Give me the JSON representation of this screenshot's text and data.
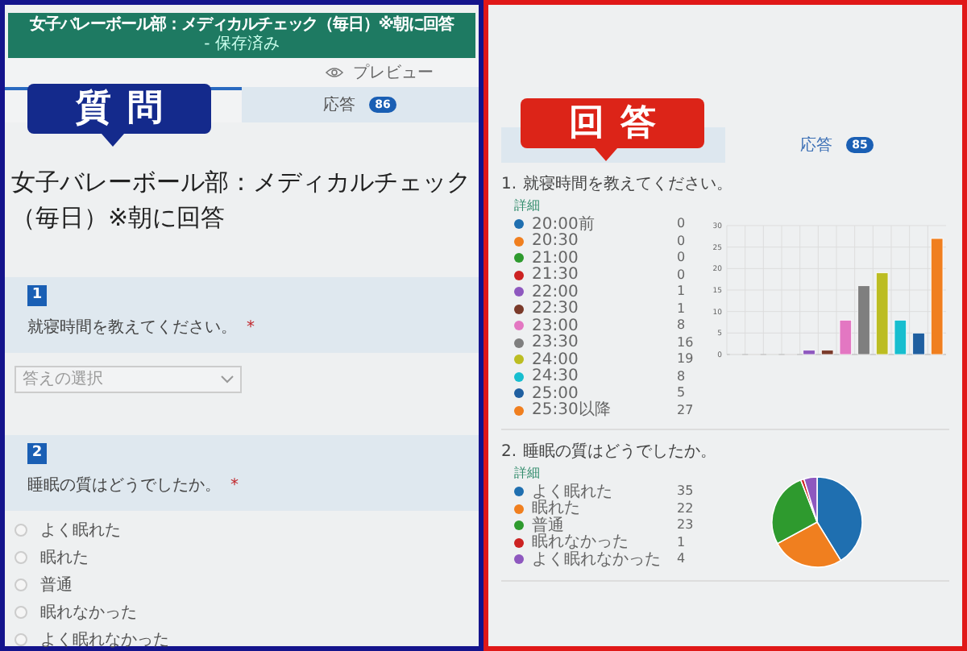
{
  "form": {
    "header": {
      "title": "女子バレーボール部：メディカルチェック（毎日）※朝に回答",
      "status": "- 保存済み"
    },
    "preview": "プレビュー",
    "tabs": [
      {
        "selected": true
      },
      {
        "label": "応答",
        "badge": "86",
        "selected": false
      }
    ],
    "callout": "質問",
    "title": "女子バレーボール部：メディカルチェック（毎日）※朝に回答",
    "questions": [
      {
        "number": "1",
        "text": "就寝時間を教えてください。",
        "mark": "*",
        "kind": "dropdown",
        "placeholder": "答えの選択"
      },
      {
        "number": "2",
        "text": "睡眠の質はどうでしたか。",
        "mark": "*",
        "kind": "choice",
        "options": [
          {
            "label": "よく眠れた",
            "selected": false
          },
          {
            "label": "眠れた",
            "selected": false
          },
          {
            "label": "普通",
            "selected": false
          },
          {
            "label": "眠れなかった",
            "selected": false
          },
          {
            "label": "よく眠れなかった",
            "selected": false
          }
        ]
      }
    ]
  },
  "responses": {
    "tabs": [
      {
        "selected": false
      },
      {
        "label": "応答",
        "badge": "85",
        "selected": true
      }
    ],
    "callout": "回答",
    "questions": [
      {
        "number": "1.",
        "text": "就寝時間を教えてください。",
        "details": "詳細",
        "items": [
          {
            "label": "20:00前",
            "count": "0",
            "color": "#1f6fb0"
          },
          {
            "label": "20:30",
            "count": "0",
            "color": "#f07f1f"
          },
          {
            "label": "21:00",
            "count": "0",
            "color": "#2e9a2e"
          },
          {
            "label": "21:30",
            "count": "0",
            "color": "#cc2222"
          },
          {
            "label": "22:00",
            "count": "1",
            "color": "#8e58bf"
          },
          {
            "label": "22:30",
            "count": "1",
            "color": "#7a3a2a"
          },
          {
            "label": "23:00",
            "count": "8",
            "color": "#e377c2"
          },
          {
            "label": "23:30",
            "count": "16",
            "color": "#7f7f7f"
          },
          {
            "label": "24:00",
            "count": "19",
            "color": "#bcbd22"
          },
          {
            "label": "24:30",
            "count": "8",
            "color": "#17becf"
          },
          {
            "label": "25:00",
            "count": "5",
            "color": "#1f5fa0"
          },
          {
            "label": "25:30以降",
            "count": "27",
            "color": "#f07f1f"
          }
        ],
        "chart_data": {
          "type": "bar",
          "values": [
            0,
            0,
            0,
            0,
            1,
            1,
            8,
            16,
            19,
            8,
            5,
            27
          ],
          "ylim": [
            0,
            30
          ],
          "yticks": [
            0,
            5,
            10,
            15,
            20,
            25,
            30
          ],
          "grid": true
        }
      },
      {
        "number": "2.",
        "text": "睡眠の質はどうでしたか。",
        "details": "詳細",
        "items": [
          {
            "label": "よく眠れた",
            "count": "35",
            "color": "#1f6fb0"
          },
          {
            "label": "眠れた",
            "count": "22",
            "color": "#f07f1f"
          },
          {
            "label": "普通",
            "count": "23",
            "color": "#2e9a2e"
          },
          {
            "label": "眠れなかった",
            "count": "1",
            "color": "#cc2222"
          },
          {
            "label": "よく眠れなかった",
            "count": "4",
            "color": "#8e58bf"
          }
        ],
        "chart_data": {
          "type": "pie",
          "values": [
            41.2,
            25.9,
            27.0,
            1.2,
            4.7
          ]
        }
      }
    ]
  }
}
